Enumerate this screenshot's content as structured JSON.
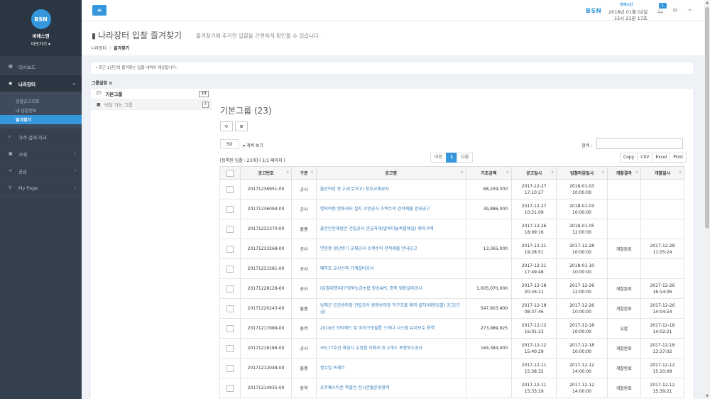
{
  "sidebar": {
    "logo": "BSN",
    "brand_name": "비에스엔",
    "brand_sub": "바로가기 ▾",
    "items": [
      {
        "label": "대시보드",
        "icon": "dashboard-icon"
      },
      {
        "label": "나라장터",
        "icon": "circle-icon"
      },
      {
        "label": "가격 검색 비교",
        "icon": "search-icon"
      },
      {
        "label": "구매",
        "icon": "cart-icon"
      },
      {
        "label": "공급",
        "icon": "share-icon"
      },
      {
        "label": "My Page",
        "icon": "map-marker-icon"
      }
    ],
    "sub_items": [
      "입찰공고조회",
      "내 입찰정보",
      "즐겨찾기"
    ]
  },
  "header": {
    "menu_icon": "≡",
    "bsn": "BSN",
    "time_label": "현재시간",
    "date": "2018년 01월 02일",
    "clock": "15시 21분 17초",
    "notification_count": "1"
  },
  "page": {
    "title": "나라장터 입찰 즐겨찾기",
    "description": "즐겨찾기에 추가한 입찰을 간편하게 확인할 수 있습니다.",
    "breadcrumb": [
      "나라장터",
      "즐겨찾기"
    ],
    "notice": "최근 1년간의 즐겨찾는 입찰 내역이 제공됩니다.",
    "group_setting": "그룹설정"
  },
  "groups": [
    {
      "label": "기본그룹",
      "count": "23"
    },
    {
      "label": "낙찰 가능 그룹",
      "count": "3"
    }
  ],
  "main": {
    "group_title": "기본그룹 (23)",
    "page_length": "50",
    "page_length_label": "▾ 개씩 보기",
    "search_label": "검색 :",
    "summary": "[등록된 입찰 : 23개] ( 1/1 페이지 )",
    "pager": [
      "이전",
      "1",
      "다음"
    ],
    "export": [
      "Copy",
      "CSV",
      "Excel",
      "Print"
    ]
  },
  "table": {
    "headers": [
      "",
      "공고번호",
      "구분",
      "공고명",
      "기초금액",
      "공고일시",
      "입찰마감일시",
      "개찰결과",
      "개찰일시"
    ],
    "rows": [
      {
        "no": "20171236951-00",
        "type": "공사",
        "name": "울산여상 등 2교(무거고) 창호교체공사",
        "amount": "68,259,300",
        "posted": [
          "2017-12-27",
          "17:10:27"
        ],
        "deadline": [
          "2018-01-03",
          "10:00:00"
        ],
        "result": "",
        "opened": [
          "",
          ""
        ]
      },
      {
        "no": "20171236094-00",
        "type": "공사",
        "name": "명덕여중 방화셔터 설치 소방공사 소액수의 견적제출 안내공고",
        "amount": "39,886,000",
        "posted": [
          "2017-12-27",
          "10:21:09"
        ],
        "deadline": [
          "2018-01-03",
          "10:00:00"
        ],
        "result": "",
        "opened": [
          "",
          ""
        ]
      },
      {
        "no": "20171232370-00",
        "type": "물품",
        "name": "울산안전체험관 건립공사 관급자재(알루미늄복합패널) 제작구매",
        "amount": "",
        "posted": [
          "2017-12-26",
          "18:09:16"
        ],
        "deadline": [
          "2018-01-05",
          "12:00:00"
        ],
        "result": "",
        "opened": [
          "",
          ""
        ]
      },
      {
        "no": "20171233268-00",
        "type": "공사",
        "name": "연암중 냉난방기 교체공사 소액수의 견적제출 안내공고",
        "amount": "13,365,000",
        "posted": [
          "2017-12-21",
          "19:28:51"
        ],
        "deadline": [
          "2017-12-28",
          "10:00:00"
        ],
        "result": "개찰완료",
        "opened": [
          "2017-12-28",
          "11:05:24"
        ]
      },
      {
        "no": "20171231581-00",
        "type": "공사",
        "name": "예하초 교사신축 기계설비공사",
        "amount": "",
        "posted": [
          "2017-12-21",
          "17:49:48"
        ],
        "deadline": [
          "2018-01-10",
          "10:00:00"
        ],
        "result": "",
        "opened": [
          "",
          ""
        ]
      },
      {
        "no": "20171228128-00",
        "type": "공사",
        "name": "(입찰대행)대구경북능금농협 청송APC 증축 냉장설비공사",
        "amount": "1,005,070,000",
        "posted": [
          "2017-12-18",
          "20:26:11"
        ],
        "deadline": [
          "2017-12-26",
          "12:00:00"
        ],
        "result": "개찰완료",
        "opened": [
          "2017-12-26",
          "16:14:06"
        ]
      },
      {
        "no": "20171220243-00",
        "type": "물품",
        "name": "남해군 공공승마장 건립공사 원형승마장 막구조물 제작·설치(대형입찰) 공고(긴급)",
        "amount": "547,903,400",
        "posted": [
          "2017-12-18",
          "08:37:46"
        ],
        "deadline": [
          "2017-12-26",
          "10:00:00"
        ],
        "result": "개찰완료",
        "opened": [
          "2017-12-26",
          "14:04:54"
        ]
      },
      {
        "no": "20171217089-00",
        "type": "용역",
        "name": "2018년 오버헤드 및 마이크로필름 스캐너 시스템 유지보수 용역",
        "amount": "273,989,925",
        "posted": [
          "2017-12-12",
          "16:01:23"
        ],
        "deadline": [
          "2017-12-18",
          "10:00:00"
        ],
        "result": "유찰",
        "opened": [
          "2017-12-18",
          "14:02:21"
        ]
      },
      {
        "no": "20171216186-00",
        "type": "공사",
        "name": "국도77호선 화성시 우정읍 이화리 등 2개소 포장보수공사",
        "amount": "164,384,000",
        "posted": [
          "2017-12-12",
          "15:40:29"
        ],
        "deadline": [
          "2017-12-18",
          "10:00:00"
        ],
        "result": "개찰완료",
        "opened": [
          "2017-12-18",
          "13:37:02"
        ]
      },
      {
        "no": "20171212048-00",
        "type": "물품",
        "name": "정수압 프레스",
        "amount": "",
        "posted": [
          "2017-12-11",
          "15:38:32"
        ],
        "deadline": [
          "2017-12-12",
          "14:00:00"
        ],
        "result": "개찰완료",
        "opened": [
          "2017-12-12",
          "15:10:09"
        ]
      },
      {
        "no": "20171214935-00",
        "type": "용역",
        "name": "호주퀘스타콘 특별전 전시연출운영용역",
        "amount": "",
        "posted": [
          "2017-12-11",
          "15:33:29"
        ],
        "deadline": [
          "2017-12-12",
          "14:00:00"
        ],
        "result": "개찰완료",
        "opened": [
          "2017-12-12",
          "15:39:21"
        ]
      }
    ]
  }
}
